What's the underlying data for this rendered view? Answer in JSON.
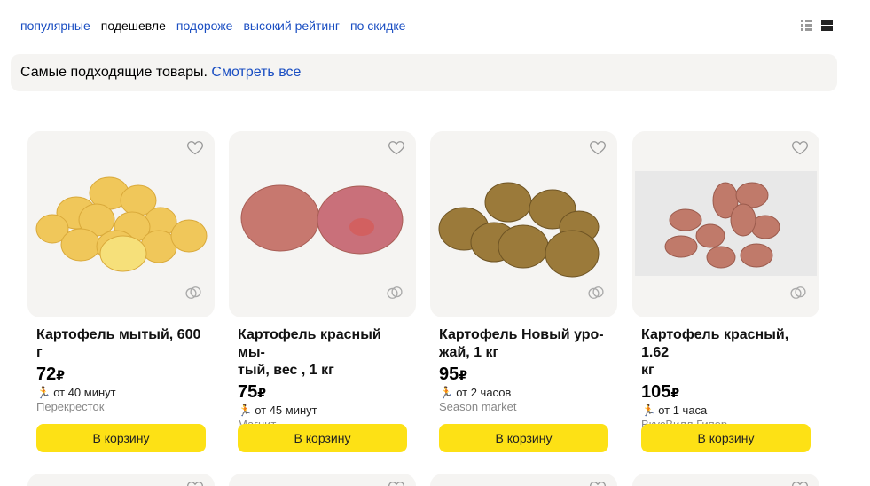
{
  "sort": {
    "options": [
      "популярные",
      "подешевле",
      "подороже",
      "высокий рейтинг",
      "по скидке"
    ],
    "active_index": 1
  },
  "view": {
    "list_icon": "list-view-icon",
    "grid_icon": "grid-view-icon",
    "active": "grid"
  },
  "notice": {
    "text": "Самые подходящие товары.",
    "link": "Смотреть все"
  },
  "products": [
    {
      "title_line1": "Картофель мытый, 600 г",
      "title_line2": "",
      "price": "72",
      "currency": "₽",
      "delivery": "от 40 минут",
      "shop": "Перекресток",
      "cart_label": "В корзину"
    },
    {
      "title_line1": "Картофель красный мы-",
      "title_line2": "тый, вес , 1 кг",
      "price": "75",
      "currency": "₽",
      "delivery": "от 45 минут",
      "shop": "Магнит",
      "cart_label": "В корзину"
    },
    {
      "title_line1": "Картофель Новый уро-",
      "title_line2": "жай, 1 кг",
      "price": "95",
      "currency": "₽",
      "delivery": "от 2 часов",
      "shop": "Season market",
      "cart_label": "В корзину"
    },
    {
      "title_line1": "Картофель красный, 1.62",
      "title_line2": "кг",
      "price": "105",
      "currency": "₽",
      "delivery": "от 1 часа",
      "shop": "ВкусВилл Гипер",
      "cart_label": "В корзину"
    }
  ],
  "colors": {
    "link": "#1a4ec2",
    "card_bg": "#f5f4f2",
    "cart_button": "#fde115"
  }
}
